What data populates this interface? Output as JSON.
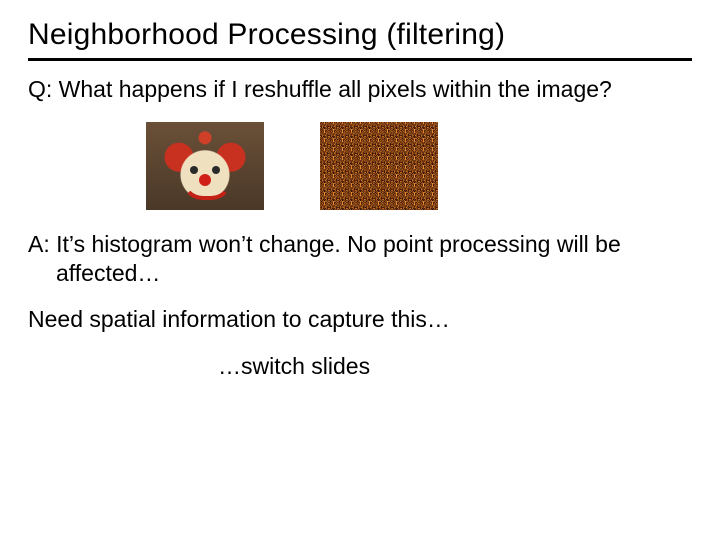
{
  "title": "Neighborhood Processing (filtering)",
  "question": "Q: What happens if I reshuffle all pixels within the image?",
  "answer": "A: It’s histogram won’t change.  No point processing will be affected…",
  "need": "Need spatial information to capture this…",
  "switch": "…switch slides",
  "images": {
    "left": "clown-image",
    "right": "shuffled-noise-image"
  }
}
